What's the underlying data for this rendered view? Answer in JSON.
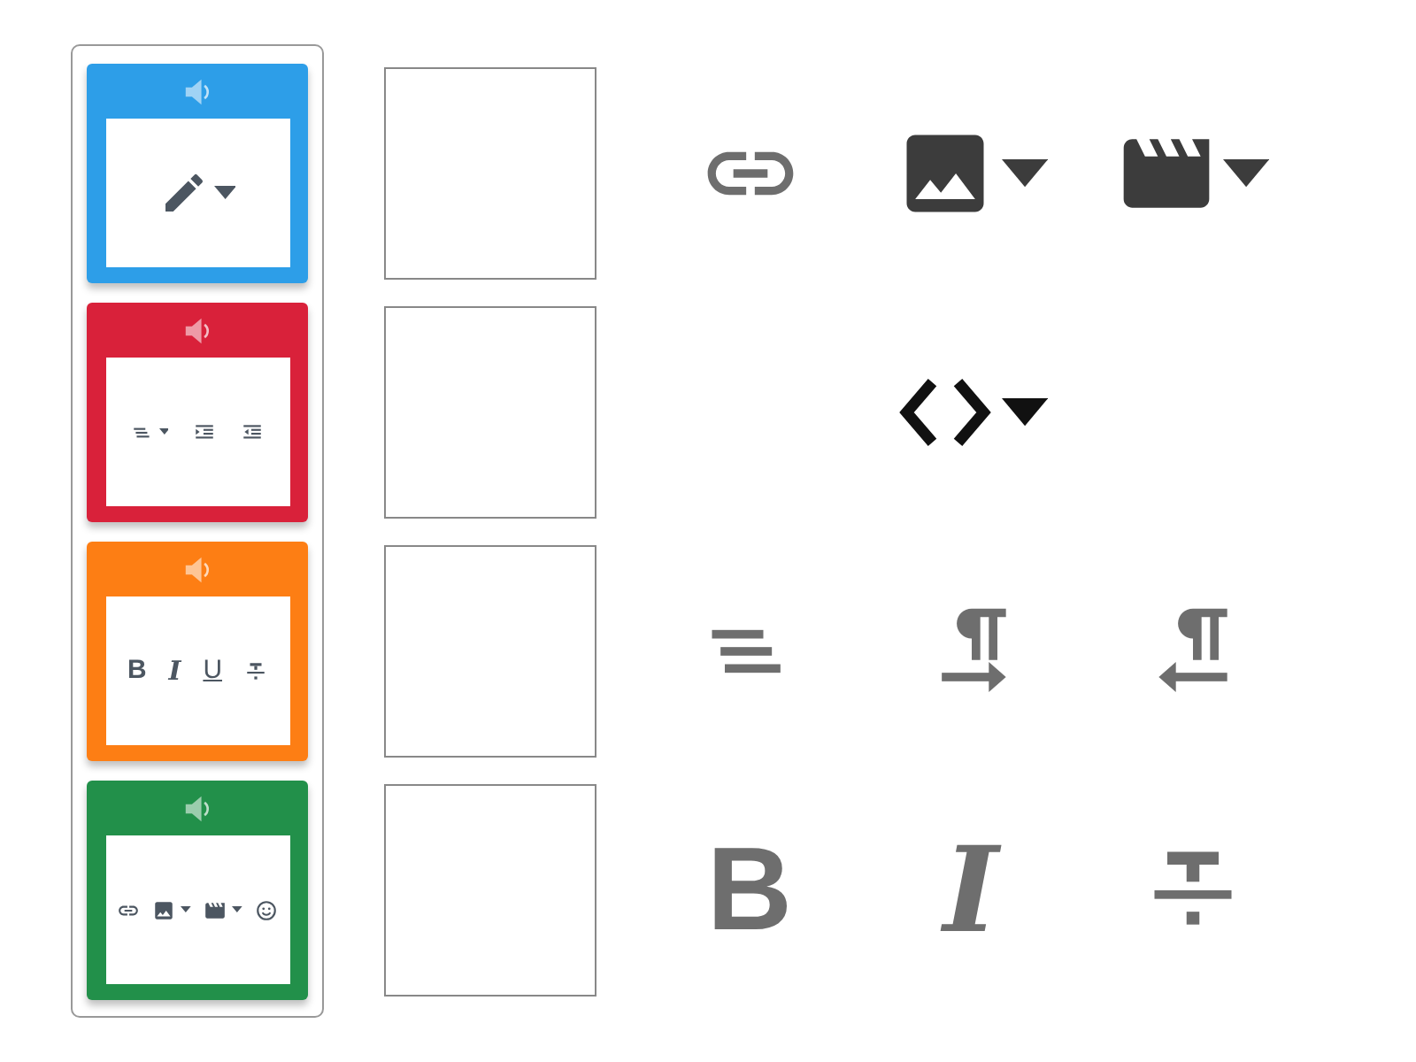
{
  "rows": [
    {
      "card": {
        "color": "#2d9ee8",
        "tools": [
          {
            "kind": "pencil",
            "dropdown": true
          }
        ]
      },
      "tools": [
        {
          "kind": "link",
          "dropdown": false
        },
        {
          "kind": "image",
          "dropdown": true
        },
        {
          "kind": "video",
          "dropdown": true
        }
      ]
    },
    {
      "card": {
        "color": "#d9213a",
        "tools": [
          {
            "kind": "align",
            "dropdown": true
          },
          {
            "kind": "indent",
            "dropdown": false
          },
          {
            "kind": "outdent",
            "dropdown": false
          }
        ]
      },
      "tools": [
        {
          "kind": "code",
          "dropdown": true
        }
      ]
    },
    {
      "card": {
        "color": "#fd7e14",
        "tools": [
          {
            "kind": "bold",
            "label": "B",
            "dropdown": false
          },
          {
            "kind": "italic",
            "label": "I",
            "dropdown": false
          },
          {
            "kind": "underline",
            "label": "U",
            "dropdown": false
          },
          {
            "kind": "strike",
            "dropdown": false
          }
        ]
      },
      "tools": [
        {
          "kind": "align",
          "dropdown": false
        },
        {
          "kind": "ltr",
          "dropdown": false
        },
        {
          "kind": "rtl",
          "dropdown": false
        }
      ]
    },
    {
      "card": {
        "color": "#22904a",
        "tools": [
          {
            "kind": "link",
            "dropdown": false
          },
          {
            "kind": "image",
            "dropdown": true
          },
          {
            "kind": "video",
            "dropdown": true
          },
          {
            "kind": "emoji",
            "dropdown": false
          }
        ]
      },
      "tools": [
        {
          "kind": "bold",
          "label": "B",
          "dropdown": false
        },
        {
          "kind": "italic",
          "label": "I",
          "dropdown": false
        },
        {
          "kind": "strike",
          "dropdown": false
        }
      ]
    }
  ]
}
